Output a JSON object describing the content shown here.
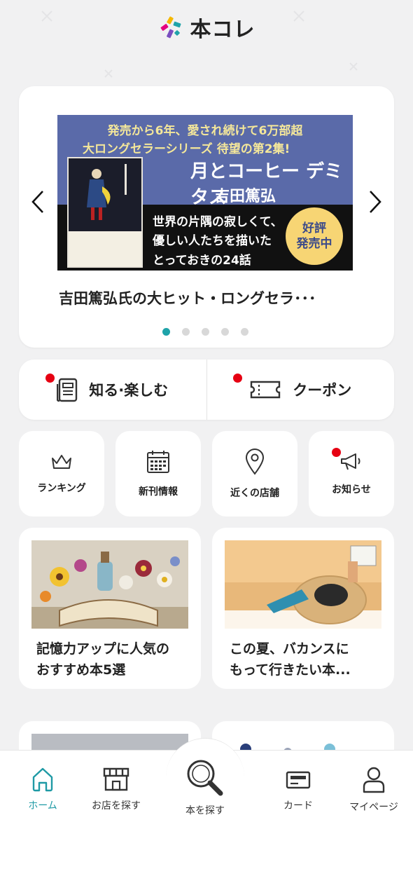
{
  "app": {
    "logo_text": "本コレ"
  },
  "carousel": {
    "banner": {
      "line1": "発売から6年、愛され続けて6万部超",
      "line2": "大ロングセラーシリーズ 待望の第2集!",
      "title": "月とコーヒー デミタス",
      "author": "吉田篤弘",
      "desc1": "世界の片隅の寂しくて、",
      "desc2": "優しい人たちを描いた",
      "desc3": "とっておきの24話",
      "badge_line1": "好評",
      "badge_line2": "発売中"
    },
    "title": "吉田篤弘氏の大ヒット・ロングセラ･･･",
    "dot_count": 5,
    "active_dot": 0,
    "accent_color": "#1fa3a9"
  },
  "split": {
    "left_label": "知る·楽しむ",
    "right_label": "クーポン"
  },
  "quick": [
    {
      "label": "ランキング",
      "icon": "crown-icon"
    },
    {
      "label": "新刊情報",
      "icon": "calendar-icon"
    },
    {
      "label": "近くの店舗",
      "icon": "map-pin-icon"
    },
    {
      "label": "お知らせ",
      "icon": "megaphone-icon"
    }
  ],
  "articles": [
    {
      "line1": "記憶力アップに人気の",
      "line2": "おすすめ本5選"
    },
    {
      "line1": "この夏、バカンスに",
      "line2": "もって行きたい本..."
    }
  ],
  "nav": {
    "home": "ホーム",
    "stores": "お店を探す",
    "search": "本を探す",
    "card": "カード",
    "mypage": "マイページ",
    "active_color": "#1f9aa5"
  },
  "notification_color": "#e60012"
}
